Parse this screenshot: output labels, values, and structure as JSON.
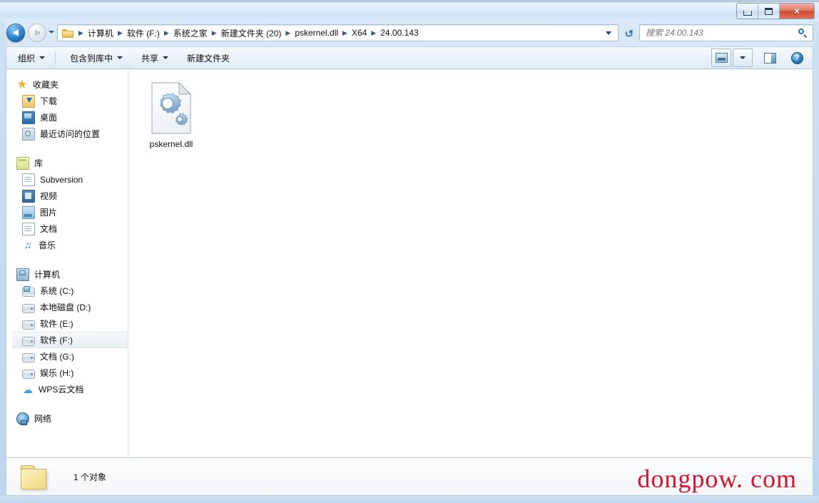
{
  "window": {
    "controls": [
      {
        "name": "minimize",
        "glyph": "minimize-icon"
      },
      {
        "name": "maximize",
        "glyph": "maximize-icon"
      },
      {
        "name": "close",
        "glyph": "×"
      }
    ]
  },
  "navigation": {
    "back_tooltip": "后退",
    "forward_tooltip": "前进",
    "history_tooltip": "最近浏览的位置",
    "refresh_tooltip": "刷新",
    "breadcrumb": [
      "计算机",
      "软件 (F:)",
      "系统之家",
      "新建文件夹 (20)",
      "pskernel.dll",
      "X64",
      "24.00.143"
    ],
    "separator": "▶"
  },
  "search": {
    "placeholder": "搜索 24.00.143",
    "value": ""
  },
  "toolbar": {
    "items": [
      {
        "label": "组织",
        "has_menu": true
      },
      {
        "label": "包含到库中",
        "has_menu": true
      },
      {
        "label": "共享",
        "has_menu": true
      },
      {
        "label": "新建文件夹",
        "has_menu": false
      }
    ],
    "right_buttons": [
      {
        "name": "view-mode-button",
        "icon": "view-mode-icon"
      },
      {
        "name": "view-mode-dropdown",
        "icon": "chevron-down-icon"
      },
      {
        "name": "preview-pane-button",
        "icon": "preview-pane-icon"
      },
      {
        "name": "help-button",
        "icon": "help-icon",
        "glyph": "?"
      }
    ]
  },
  "sidebar": {
    "groups": [
      {
        "root": {
          "label": "收藏夹",
          "icon": "star-icon"
        },
        "items": [
          {
            "label": "下载",
            "icon": "downloads-icon"
          },
          {
            "label": "桌面",
            "icon": "desktop-icon"
          },
          {
            "label": "最近访问的位置",
            "icon": "recent-places-icon"
          }
        ]
      },
      {
        "root": {
          "label": "库",
          "icon": "library-icon"
        },
        "items": [
          {
            "label": "Subversion",
            "icon": "document-icon"
          },
          {
            "label": "视频",
            "icon": "video-icon"
          },
          {
            "label": "图片",
            "icon": "picture-icon"
          },
          {
            "label": "文档",
            "icon": "document-icon"
          },
          {
            "label": "音乐",
            "icon": "music-icon"
          }
        ]
      },
      {
        "root": {
          "label": "计算机",
          "icon": "computer-icon"
        },
        "items": [
          {
            "label": "系统 (C:)",
            "icon": "system-drive-icon",
            "selected": false
          },
          {
            "label": "本地磁盘 (D:)",
            "icon": "drive-icon",
            "selected": false
          },
          {
            "label": "软件 (E:)",
            "icon": "drive-icon",
            "selected": false
          },
          {
            "label": "软件 (F:)",
            "icon": "drive-icon",
            "selected": true
          },
          {
            "label": "文档 (G:)",
            "icon": "drive-icon",
            "selected": false
          },
          {
            "label": "娱乐 (H:)",
            "icon": "drive-icon",
            "selected": false
          },
          {
            "label": "WPS云文档",
            "icon": "cloud-icon",
            "selected": false
          }
        ]
      },
      {
        "root": {
          "label": "网络",
          "icon": "network-icon"
        },
        "items": []
      }
    ]
  },
  "files": [
    {
      "name": "pskernel.dll",
      "icon": "dll-gear-icon",
      "selected": false
    }
  ],
  "status": {
    "count_text": "1 个对象",
    "folder_icon": "folder-icon"
  },
  "watermark": {
    "text": "dongpow. com",
    "color": "#d4142c"
  },
  "colors": {
    "titlebar": "#dceaf8",
    "frame": "#cfe1f4",
    "accent": "#2f86ce",
    "close_button": "#cb4b33",
    "selection": "#e9eef3"
  }
}
